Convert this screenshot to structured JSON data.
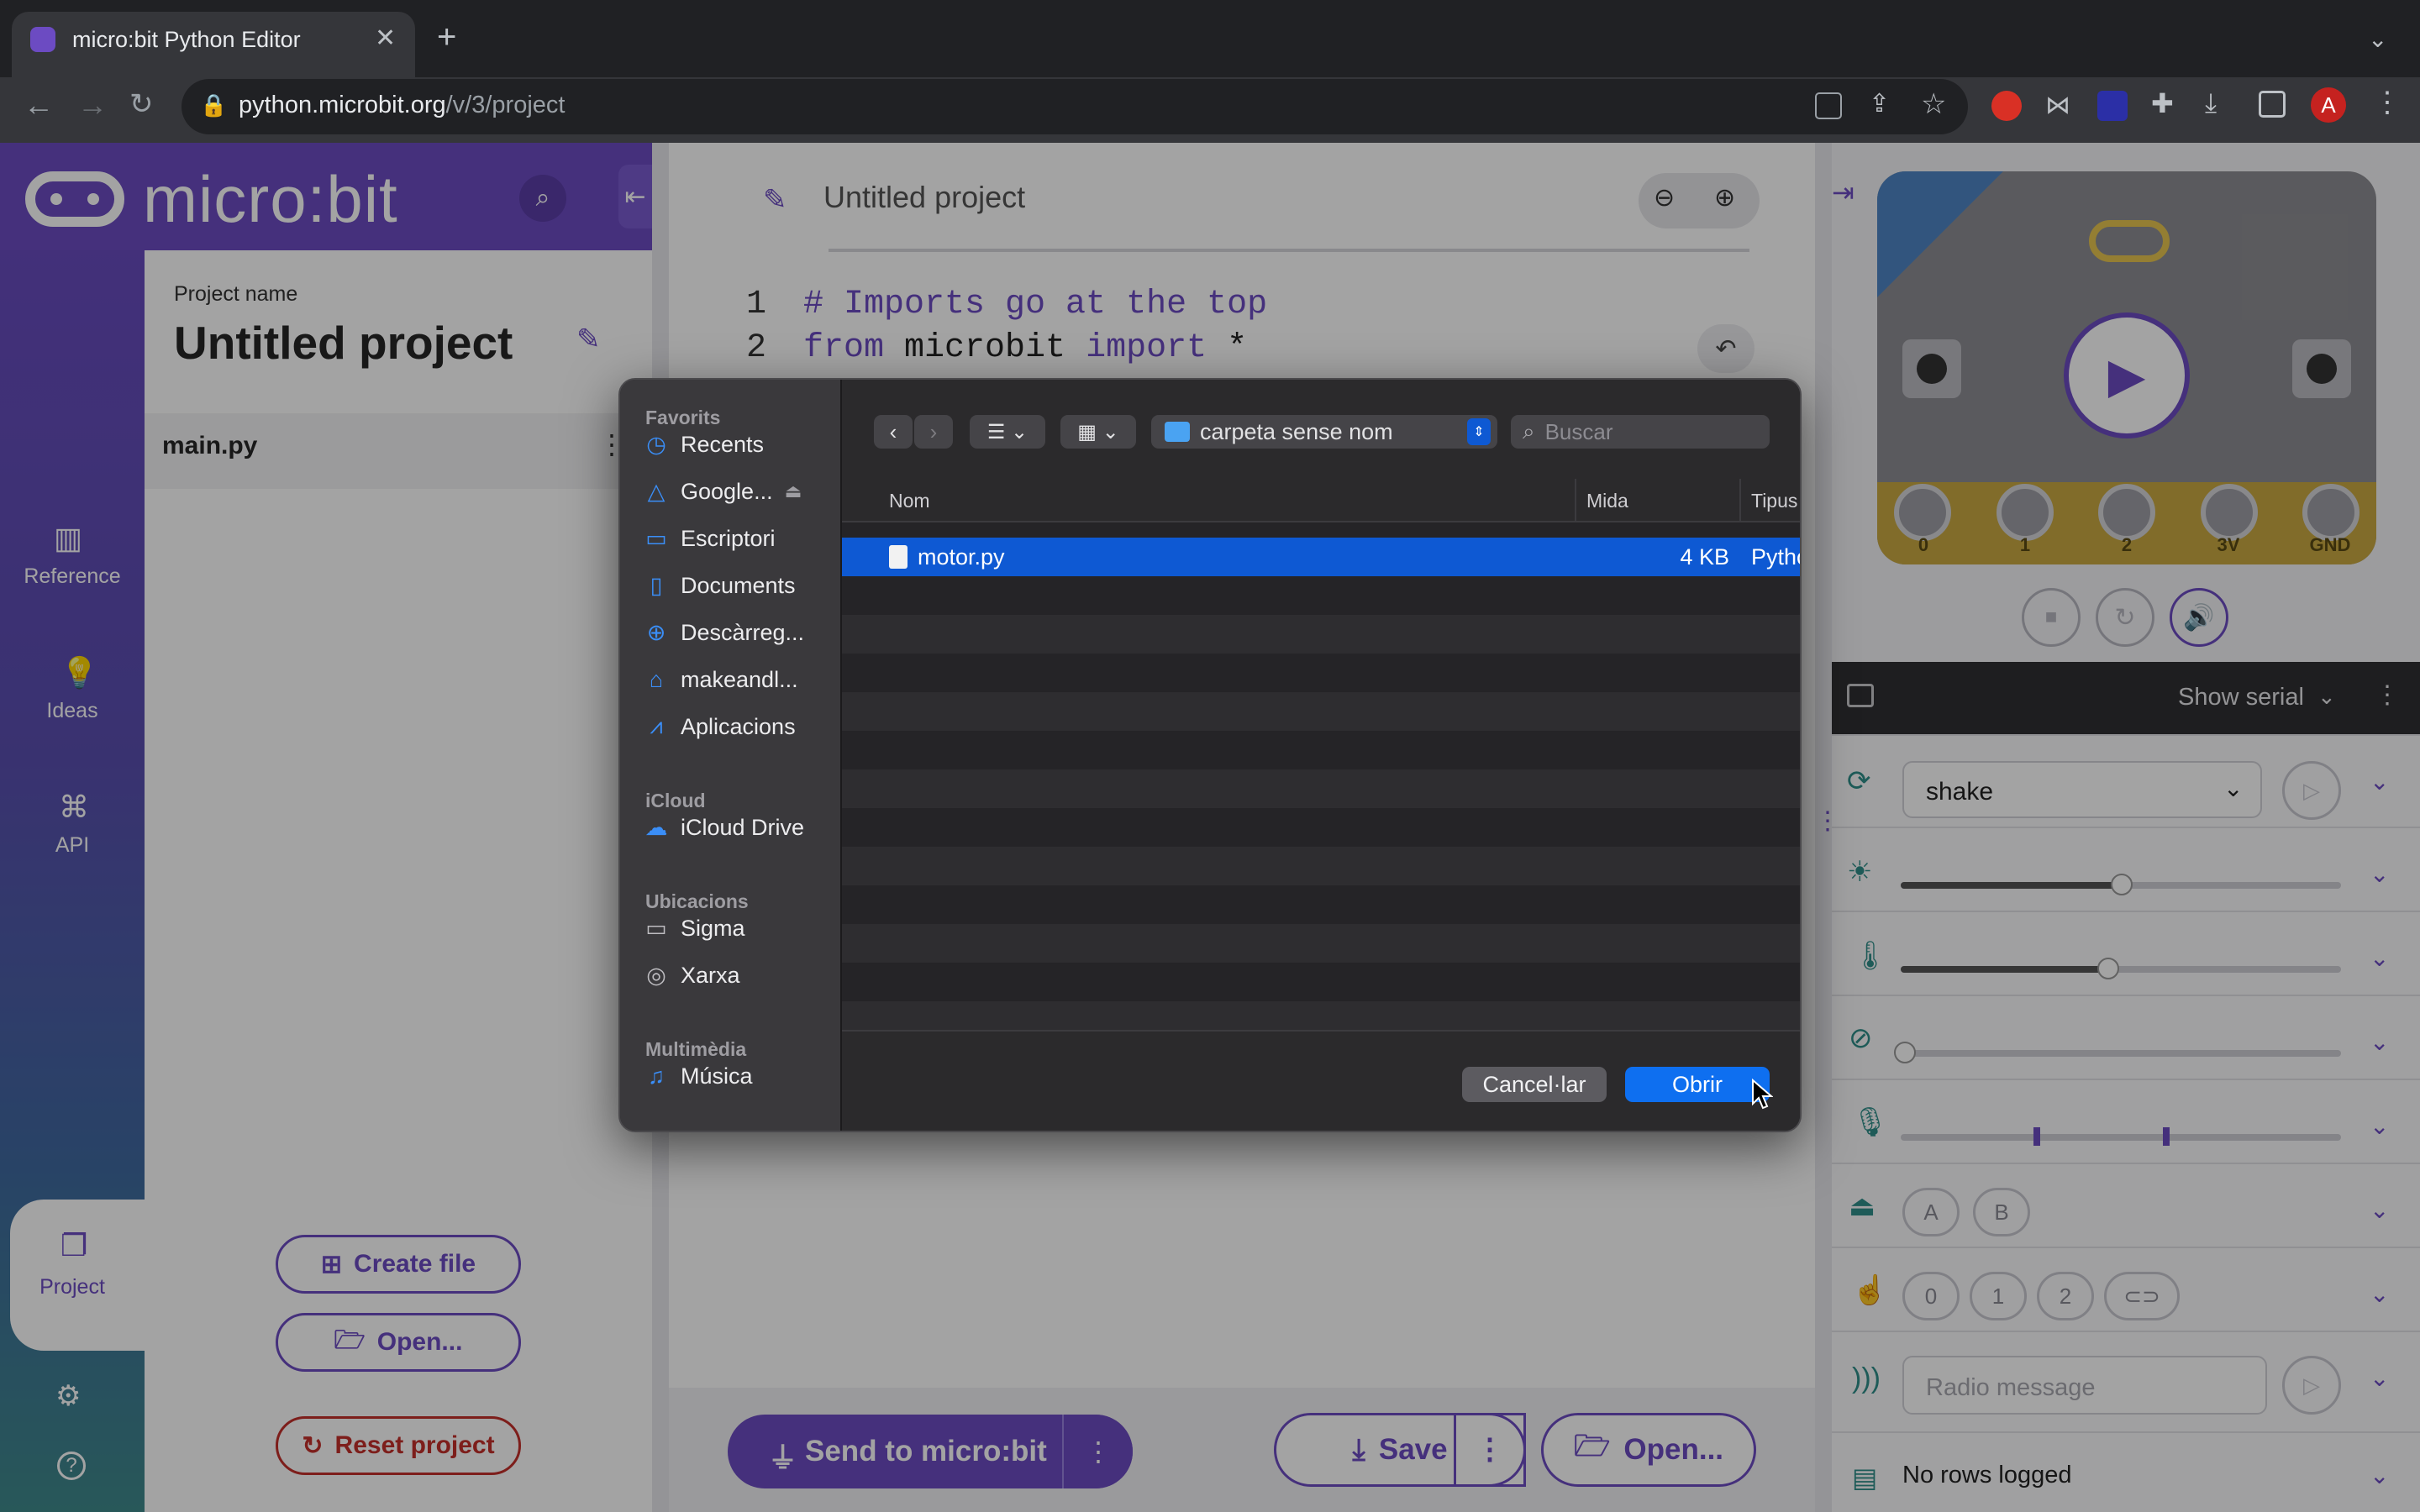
{
  "browser": {
    "tab_title": "micro:bit Python Editor",
    "url_host": "python.microbit.org",
    "url_path": "/v/3/project",
    "profile_initial": "A"
  },
  "app": {
    "logo_text": "micro:bit",
    "nav": {
      "reference": "Reference",
      "ideas": "Ideas",
      "api": "API",
      "project": "Project"
    },
    "project": {
      "name_label": "Project name",
      "name": "Untitled project",
      "file": "main.py",
      "create_file": "Create file",
      "open": "Open...",
      "reset": "Reset project"
    },
    "editor": {
      "title": "Untitled project",
      "lines": [
        {
          "no": "1",
          "comment": "# Imports go at the top"
        },
        {
          "no": "2",
          "kw1": "from",
          "mod": " microbit ",
          "kw2": "import",
          "rest": " *"
        }
      ]
    },
    "actions": {
      "send": "Send to micro:bit",
      "save": "Save",
      "open": "Open..."
    },
    "simulator": {
      "pin_labels": [
        "0",
        "1",
        "2",
        "3V",
        "GND"
      ],
      "serial_label": "Show serial",
      "gesture": "shake",
      "button_a": "A",
      "button_b": "B",
      "touch_pins": [
        "0",
        "1",
        "2"
      ],
      "radio_placeholder": "Radio message",
      "log_text": "No rows logged",
      "light_level": 0.5,
      "temperature_level": 0.47
    }
  },
  "dialog": {
    "sidebar": {
      "favorites_head": "Favorits",
      "favorites": [
        "Recents",
        "Google...",
        "Escriptori",
        "Documents",
        "Descàrreg...",
        "makeandl...",
        "Aplicacions"
      ],
      "icloud_head": "iCloud",
      "icloud": [
        "iCloud Drive"
      ],
      "locations_head": "Ubicacions",
      "locations": [
        "Sigma",
        "Xarxa"
      ],
      "media_head": "Multimèdia",
      "media": [
        "Música"
      ]
    },
    "folder": "carpeta sense nom",
    "search_placeholder": "Buscar",
    "columns": {
      "name": "Nom",
      "size": "Mida",
      "kind": "Tipus"
    },
    "file": {
      "name": "motor.py",
      "size": "4 KB",
      "kind": "Pytho"
    },
    "cancel": "Cancel·lar",
    "open": "Obrir",
    "accent": "#0e59d3"
  }
}
